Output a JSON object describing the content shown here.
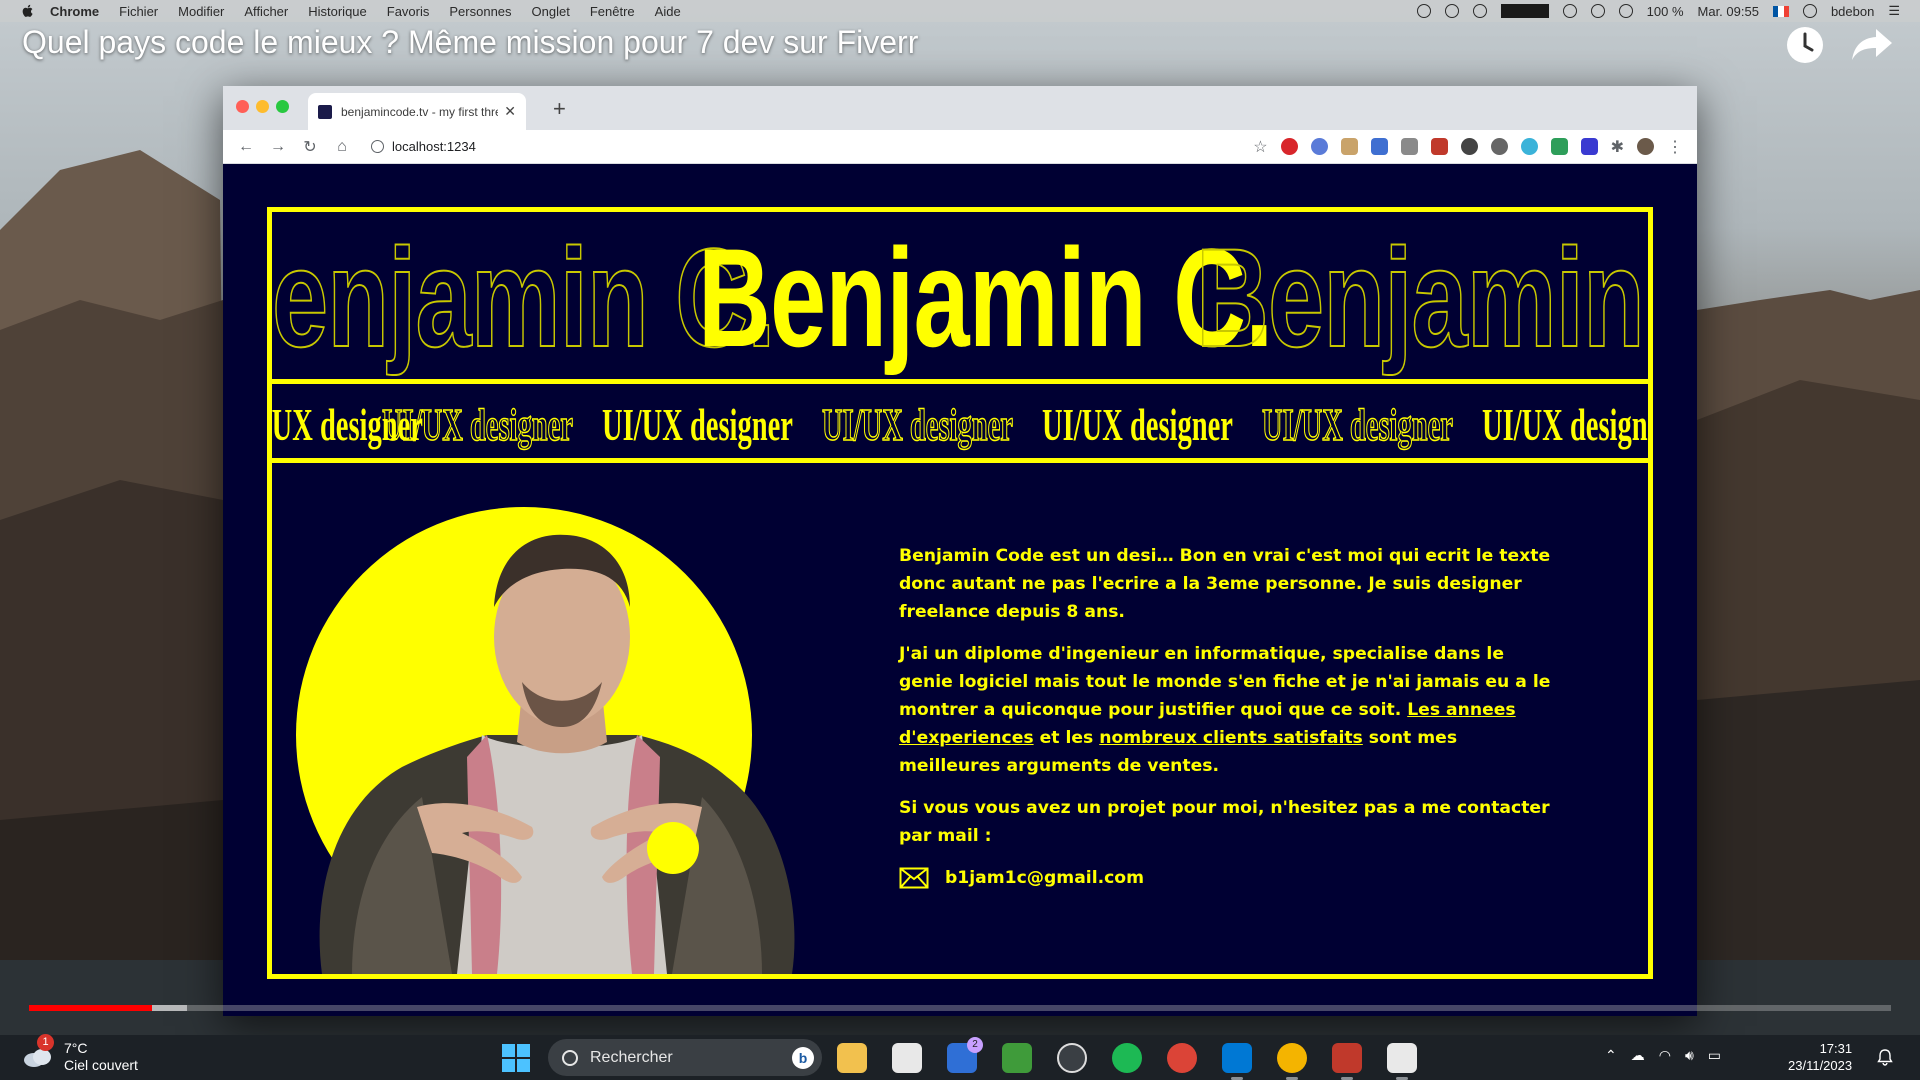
{
  "mac_menubar": {
    "items": [
      "Chrome",
      "Fichier",
      "Modifier",
      "Afficher",
      "Historique",
      "Favoris",
      "Personnes",
      "Onglet",
      "Fenêtre",
      "Aide"
    ],
    "battery": "100 %",
    "datetime": "Mar. 09:55",
    "user": "bdebon"
  },
  "video": {
    "title": "Quel pays code le mieux ? Même mission pour 7 dev sur Fiverr",
    "played_fraction": 0.066,
    "buffered_fraction": 0.085
  },
  "browser": {
    "tab_title": "benjamincode.tv - my first thre",
    "url": "localhost:1234"
  },
  "page": {
    "name_repeat": "Benjamin C.",
    "role_repeat": "UI/UX designer",
    "bio": {
      "p1": "Benjamin Code est un desi… Bon en vrai c'est moi qui ecrit le texte donc autant ne pas l'ecrire a la 3eme personne. Je suis designer freelance depuis 8 ans.",
      "p2_before": "J'ai un diplome d'ingenieur en informatique, specialise dans le genie logiciel mais tout le monde s'en fiche et je n'ai jamais eu a le montrer a quiconque pour justifier quoi que ce soit. ",
      "p2_link1": "Les annees d'experiences",
      "p2_mid": " et les ",
      "p2_link2": "nombreux clients satisfaits",
      "p2_after": " sont mes meilleures arguments de ventes.",
      "p3": "Si vous vous avez un projet pour moi, n'hesitez pas a me contacter par mail :"
    },
    "email": "b1jam1c@gmail.com",
    "colors": {
      "background": "#000033",
      "accent": "#ffff00"
    }
  },
  "taskbar": {
    "weather_temp": "7°C",
    "weather_desc": "Ciel couvert",
    "weather_badge": "1",
    "search_placeholder": "Rechercher",
    "app_badge": "2",
    "time": "17:31",
    "date": "23/11/2023"
  }
}
